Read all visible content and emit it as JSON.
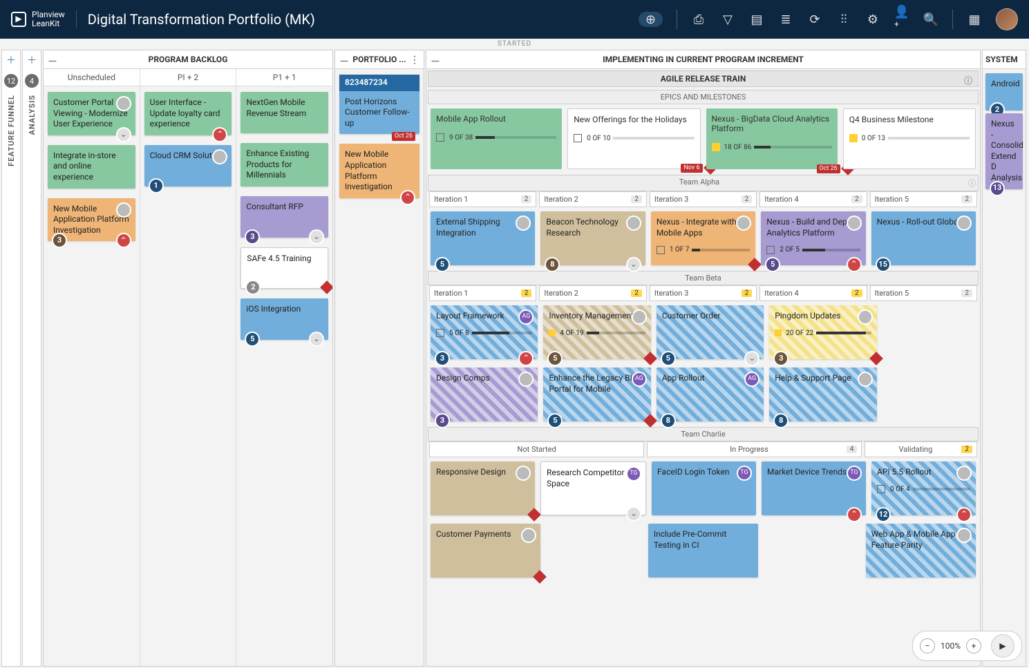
{
  "app": {
    "brand_top": "Planview",
    "brand_bottom": "LeanKit",
    "board_title": "Digital Transformation Portfolio (MK)"
  },
  "topbar": {
    "started": "STARTED"
  },
  "collapsed_lanes": {
    "feature_funnel": {
      "label": "FEATURE FUNNEL",
      "count": "12"
    },
    "analysis": {
      "label": "ANALYSIS",
      "count": "4"
    }
  },
  "backlog": {
    "title": "PROGRAM BACKLOG",
    "cols": {
      "unscheduled": {
        "title": "Unscheduled"
      },
      "pi2": {
        "title": "PI + 2"
      },
      "pi1": {
        "title": "P1 + 1"
      }
    },
    "cards": {
      "c1": "Customer Portal Viewing - Modernize User Experience",
      "c2": "Integrate in-store and online experience",
      "c3": "New Mobile Application Platform Investigation",
      "c4": "User Interface - Update loyalty card experience",
      "c5": "Cloud CRM Solution",
      "c6": "NextGen Mobile Revenue Stream",
      "c7": "Enhance Existing Products for Millennials",
      "c8": "Consultant RFP",
      "c9": "SAFe 4.5 Training",
      "c10": "iOS Integration"
    },
    "badges": {
      "c3": "3",
      "c5": "1",
      "c8": "3",
      "c9": "2",
      "c10": "5"
    }
  },
  "portfolio": {
    "title": "PORTFOLIO ...",
    "cards": {
      "p1id": "823487234",
      "p1": "Post Horizons Customer Follow-up",
      "p2": "New Mobile Application Platform Investigation"
    },
    "p1_date": "Oct 26"
  },
  "impl": {
    "title": "IMPLEMENTING IN CURRENT PROGRAM INCREMENT",
    "art": "AGILE RELEASE TRAIN",
    "epics_h": "EPICS AND MILESTONES",
    "epics": {
      "e1": "Mobile App Rollout",
      "e1p": "9 OF 38",
      "e2": "New Offerings for the Holidays",
      "e2p": "0 OF 10",
      "e3": "Nexus - BigData Cloud Analytics Platform",
      "e3p": "18 OF 86",
      "e4": "Q4 Business Milestone",
      "e4p": "0 OF 13",
      "e2_date": "Nov 6",
      "e3_date": "Oct 26"
    },
    "team_alpha": "Team Alpha",
    "alpha_iter": {
      "i1": "Iteration 1",
      "i2": "Iteration 2",
      "i3": "Iteration 3",
      "i4": "Iteration 4",
      "i5": "Iteration 5",
      "n": "2"
    },
    "alpha_cards": {
      "a1": "External Shipping Integration",
      "a1b": "5",
      "a2": "Beacon Technology Research",
      "a2b": "8",
      "a3": "Nexus - Integrate with Mobile Apps",
      "a3p": "1 OF 7",
      "a4": "Nexus - Build and Deploy Analytics Platform",
      "a4p": "2 OF 5",
      "a4b": "5",
      "a5": "Nexus - Roll-out Globally",
      "a5b": "15"
    },
    "team_beta": "Team Beta",
    "beta_iter": {
      "i1": "Iteration 1",
      "i2": "Iteration 2",
      "i3": "Iteration 3",
      "i4": "Iteration 4",
      "i5": "Iteration 5",
      "n": "2"
    },
    "beta_cards": {
      "b1": "Layout Framework",
      "b1p": "5 OF 8",
      "b1b": "3",
      "b2": "Inventory Management",
      "b2p": "4 OF 19",
      "b2b": "5",
      "b3": "Customer Order",
      "b3b": "5",
      "b4": "Pingdom Updates",
      "b4p": "20 OF 22",
      "b4b": "3",
      "b5": "Design Comps",
      "b5b": "3",
      "b6": "Enhance the Legacy BI Portal for Mobile",
      "b6b": "5",
      "b7": "App Rollout",
      "b7b": "8",
      "b8": "Help & Support Page",
      "b8b": "8"
    },
    "team_charlie": "Team Charlie",
    "charlie_cols": {
      "c1": "Not Started",
      "c2": "In Progress",
      "c2n": "4",
      "c3": "Validating",
      "c3n": "2"
    },
    "charlie_cards": {
      "d1": "Responsive Design",
      "d2": "Research Competitor Space",
      "d3": "FaceID Login Token",
      "d4": "Market Device Trends",
      "d5": "API 5.5 Rollout",
      "d5p": "0 OF 4",
      "d5b": "12",
      "d6": "Customer Payments",
      "d7": "Include Pre-Commit Testing in CI",
      "d8": "Web App & Mobile App Feature Parity"
    },
    "avatars": {
      "ag": "AG",
      "tg": "TG"
    }
  },
  "system": {
    "title": "SYSTEM",
    "c1": "Android",
    "c1b": "2",
    "c2": "Nexus - Consolid Extend D Analysis",
    "c2b": "13"
  },
  "zoom": {
    "pct": "100%"
  }
}
